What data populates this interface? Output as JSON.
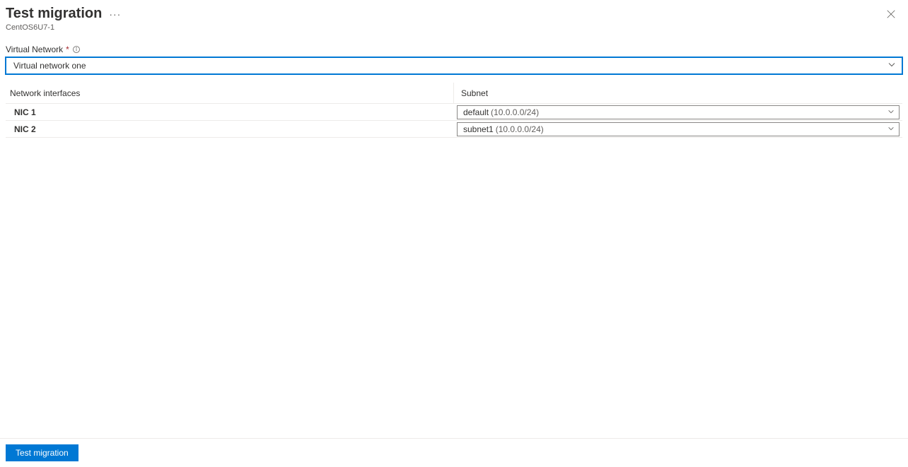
{
  "header": {
    "title": "Test migration",
    "subtitle": "CentOS6U7-1"
  },
  "virtualNetwork": {
    "label": "Virtual Network",
    "selected": "Virtual network one"
  },
  "table": {
    "headers": {
      "nic": "Network interfaces",
      "subnet": "Subnet"
    },
    "rows": [
      {
        "nic": "NIC 1",
        "subnetPrimary": "default",
        "subnetSecondary": "(10.0.0.0/24)"
      },
      {
        "nic": "NIC 2",
        "subnetPrimary": "subnet1",
        "subnetSecondary": "(10.0.0.0/24)"
      }
    ]
  },
  "footer": {
    "primaryButton": "Test migration"
  }
}
